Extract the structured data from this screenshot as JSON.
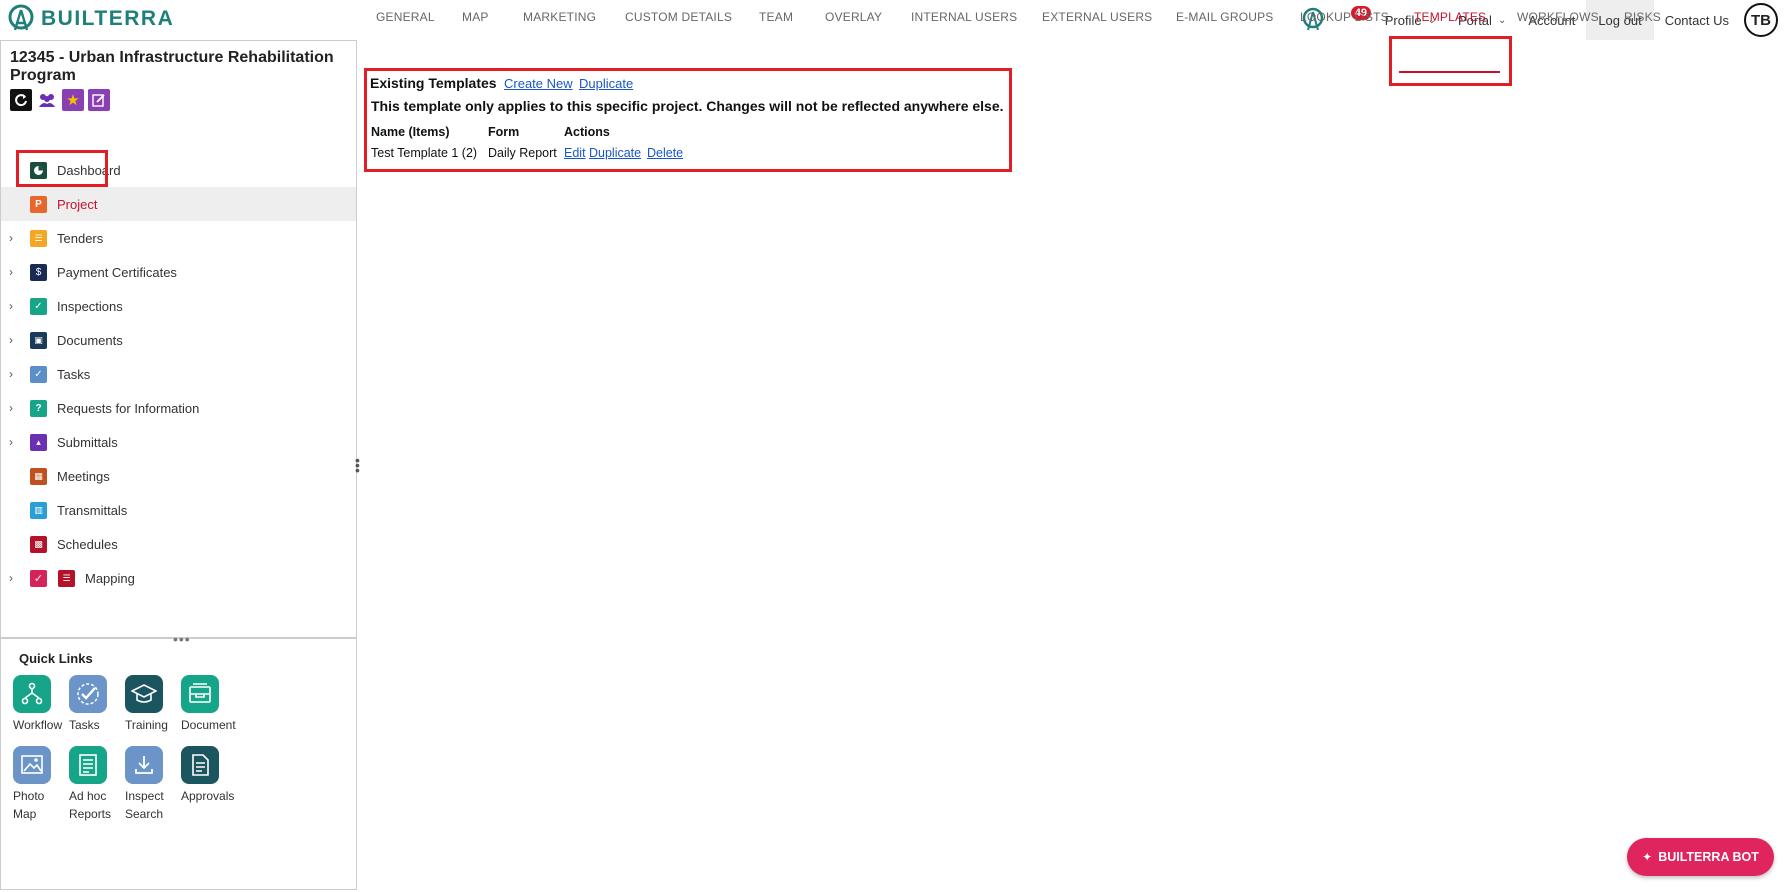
{
  "app": {
    "brand": "BUILTERRA",
    "accent": "#c8102e",
    "brand_color": "#1f7f7a"
  },
  "topnav": {
    "notification_count": "49",
    "profile": "Profile",
    "portal": "Portal",
    "account": "Account",
    "logout": "Log out",
    "contact": "Contact Us",
    "avatar_initials": "TB"
  },
  "sidebar": {
    "project_title": "12345 - Urban Infrastructure Rehabilitation Program",
    "items": [
      {
        "label": "Dashboard",
        "icon": "dashboard-icon",
        "expandable": false
      },
      {
        "label": "Project",
        "icon": "project-icon",
        "expandable": false,
        "selected": true
      },
      {
        "label": "Tenders",
        "icon": "tenders-icon",
        "expandable": true
      },
      {
        "label": "Payment Certificates",
        "icon": "payment-certificates-icon",
        "expandable": true
      },
      {
        "label": "Inspections",
        "icon": "inspections-icon",
        "expandable": true
      },
      {
        "label": "Documents",
        "icon": "documents-icon",
        "expandable": true
      },
      {
        "label": "Tasks",
        "icon": "tasks-icon",
        "expandable": true
      },
      {
        "label": "Requests for Information",
        "icon": "rfi-icon",
        "expandable": true
      },
      {
        "label": "Submittals",
        "icon": "submittals-icon",
        "expandable": true
      },
      {
        "label": "Meetings",
        "icon": "meetings-icon",
        "expandable": false
      },
      {
        "label": "Transmittals",
        "icon": "transmittals-icon",
        "expandable": false
      },
      {
        "label": "Schedules",
        "icon": "schedules-icon",
        "expandable": false
      },
      {
        "label": "Mapping",
        "icon": "mapping-icon",
        "expandable": true
      }
    ]
  },
  "quick_links": {
    "title": "Quick Links",
    "items": [
      {
        "label": "Workflow",
        "icon": "workflow-icon"
      },
      {
        "label": "Tasks",
        "icon": "tasks-check-icon"
      },
      {
        "label": "Training",
        "icon": "graduation-cap-icon"
      },
      {
        "label": "Document",
        "icon": "document-tray-icon"
      },
      {
        "label": "Photo Map",
        "icon": "photo-map-icon"
      },
      {
        "label": "Ad hoc Reports",
        "icon": "report-icon"
      },
      {
        "label": "Inspect Search",
        "icon": "download-icon"
      },
      {
        "label": "Approvals",
        "icon": "approvals-icon"
      }
    ]
  },
  "tabs": [
    {
      "label": "GENERAL"
    },
    {
      "label": "MAP"
    },
    {
      "label": "MARKETING"
    },
    {
      "label": "CUSTOM DETAILS"
    },
    {
      "label": "TEAM"
    },
    {
      "label": "OVERLAY"
    },
    {
      "label": "INTERNAL USERS"
    },
    {
      "label": "EXTERNAL USERS"
    },
    {
      "label": "E-MAIL GROUPS"
    },
    {
      "label": "LOOKUP LISTS"
    },
    {
      "label": "TEMPLATES",
      "active": true
    },
    {
      "label": "WORKFLOWS"
    },
    {
      "label": "RISKS"
    }
  ],
  "templates": {
    "title": "Existing Templates",
    "create_new": "Create New",
    "duplicate": "Duplicate",
    "notice": "This template only applies to this specific project. Changes will not be reflected anywhere else.",
    "columns": [
      "Name (Items)",
      "Form",
      "Actions"
    ],
    "rows": [
      {
        "name": "Test Template 1 (2)",
        "form": "Daily Report",
        "actions": [
          "Edit",
          "Duplicate",
          "Delete"
        ]
      }
    ]
  },
  "bot": {
    "label": "BUILTERRA BOT"
  }
}
